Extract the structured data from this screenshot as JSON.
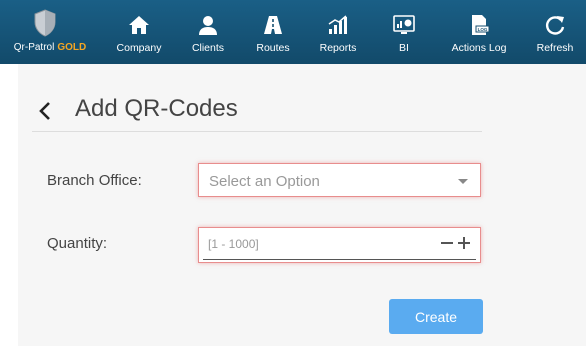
{
  "brand": {
    "name": "Qr-Patrol",
    "tier": "GOLD"
  },
  "nav": [
    {
      "label": "Company",
      "icon": "home-icon"
    },
    {
      "label": "Clients",
      "icon": "user-icon"
    },
    {
      "label": "Routes",
      "icon": "road-icon"
    },
    {
      "label": "Reports",
      "icon": "bar-chart-icon"
    },
    {
      "label": "BI",
      "icon": "dashboard-icon"
    },
    {
      "label": "Actions Log",
      "icon": "log-icon"
    },
    {
      "label": "Refresh",
      "icon": "refresh-icon"
    }
  ],
  "page": {
    "title": "Add QR-Codes"
  },
  "form": {
    "branch_label": "Branch Office:",
    "branch_placeholder": "Select an Option",
    "quantity_label": "Quantity:",
    "quantity_placeholder": "[1 - 1000]",
    "create_label": "Create"
  },
  "colors": {
    "header": "#164f70",
    "accent": "#f5a623",
    "button": "#5aabf0",
    "invalid_border": "#e88d8d"
  }
}
